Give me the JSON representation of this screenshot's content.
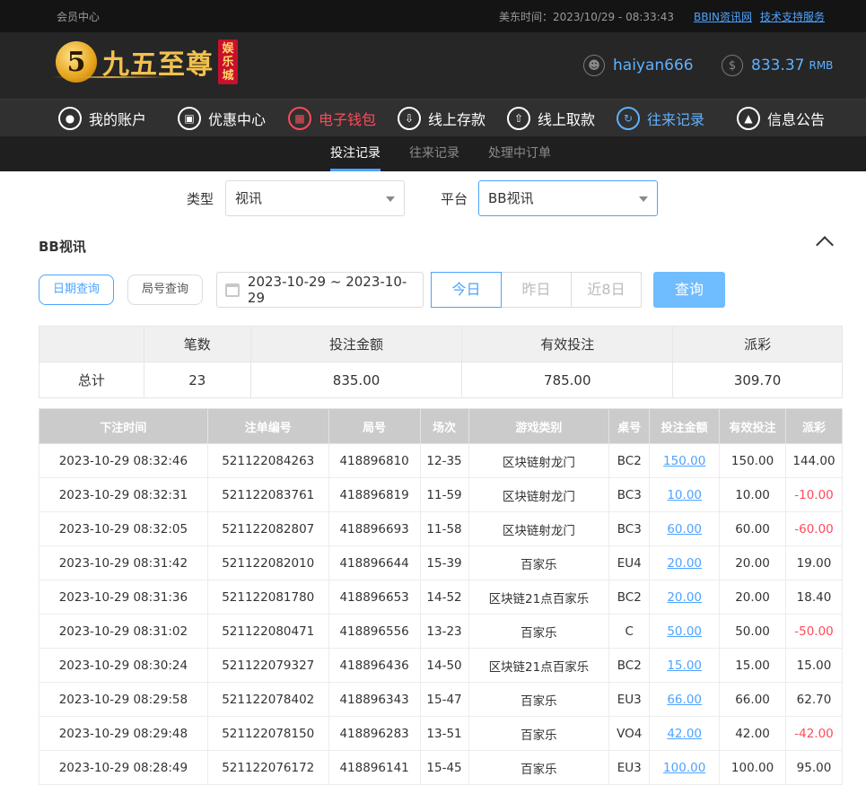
{
  "topbar": {
    "member_center": "会员中心",
    "time_label": "美东时间：2023/10/29 - 08:33:43",
    "link_bbin": "BBIN资讯网",
    "link_support": "技术支持服务"
  },
  "header": {
    "logo_mark": "5",
    "logo_text": "九五至尊",
    "logo_badge": "娱乐城",
    "username": "haiyan666",
    "balance": "833.37",
    "currency": "RMB"
  },
  "mainnav": [
    {
      "label": "我的账户",
      "icon": "user-icon"
    },
    {
      "label": "优惠中心",
      "icon": "gift-icon"
    },
    {
      "label": "电子钱包",
      "icon": "wallet-icon"
    },
    {
      "label": "线上存款",
      "icon": "deposit-icon"
    },
    {
      "label": "线上取款",
      "icon": "withdraw-icon"
    },
    {
      "label": "往来记录",
      "icon": "record-icon"
    },
    {
      "label": "信息公告",
      "icon": "bell-icon"
    }
  ],
  "subnav": [
    "投注记录",
    "往来记录",
    "处理中订单"
  ],
  "filters": {
    "type_label": "类型",
    "type_value": "视讯",
    "platform_label": "平台",
    "platform_value": "BB视讯"
  },
  "section_title": "BB视讯",
  "query": {
    "date_query": "日期查询",
    "round_query": "局号查询",
    "date_range": "2023-10-29 ~ 2023-10-29",
    "today": "今日",
    "yesterday": "昨日",
    "last8": "近8日",
    "submit": "查询"
  },
  "summary": {
    "headers": [
      "",
      "笔数",
      "投注金额",
      "有效投注",
      "派彩"
    ],
    "row": [
      "总计",
      "23",
      "835.00",
      "785.00",
      "309.70"
    ]
  },
  "detail": {
    "headers": [
      "下注时间",
      "注单编号",
      "局号",
      "场次",
      "游戏类别",
      "桌号",
      "投注金额",
      "有效投注",
      "派彩"
    ],
    "rows": [
      [
        "2023-10-29 08:32:46",
        "521122084263",
        "418896810",
        "12-35",
        "区块链射龙门",
        "BC2",
        "150.00",
        "150.00",
        "144.00"
      ],
      [
        "2023-10-29 08:32:31",
        "521122083761",
        "418896819",
        "11-59",
        "区块链射龙门",
        "BC3",
        "10.00",
        "10.00",
        "-10.00"
      ],
      [
        "2023-10-29 08:32:05",
        "521122082807",
        "418896693",
        "11-58",
        "区块链射龙门",
        "BC3",
        "60.00",
        "60.00",
        "-60.00"
      ],
      [
        "2023-10-29 08:31:42",
        "521122082010",
        "418896644",
        "15-39",
        "百家乐",
        "EU4",
        "20.00",
        "20.00",
        "19.00"
      ],
      [
        "2023-10-29 08:31:36",
        "521122081780",
        "418896653",
        "14-52",
        "区块链21点百家乐",
        "BC2",
        "20.00",
        "20.00",
        "18.40"
      ],
      [
        "2023-10-29 08:31:02",
        "521122080471",
        "418896556",
        "13-23",
        "百家乐",
        "C",
        "50.00",
        "50.00",
        "-50.00"
      ],
      [
        "2023-10-29 08:30:24",
        "521122079327",
        "418896436",
        "14-50",
        "区块链21点百家乐",
        "BC2",
        "15.00",
        "15.00",
        "15.00"
      ],
      [
        "2023-10-29 08:29:58",
        "521122078402",
        "418896343",
        "15-47",
        "百家乐",
        "EU3",
        "66.00",
        "66.00",
        "62.70"
      ],
      [
        "2023-10-29 08:29:48",
        "521122078150",
        "418896283",
        "13-51",
        "百家乐",
        "VO4",
        "42.00",
        "42.00",
        "-42.00"
      ],
      [
        "2023-10-29 08:28:49",
        "521122076172",
        "418896141",
        "15-45",
        "百家乐",
        "EU3",
        "100.00",
        "100.00",
        "95.00"
      ]
    ]
  },
  "colors": {
    "accent": "#4da3ff",
    "negative": "#ff4a5a",
    "header_bg": "#262626"
  }
}
